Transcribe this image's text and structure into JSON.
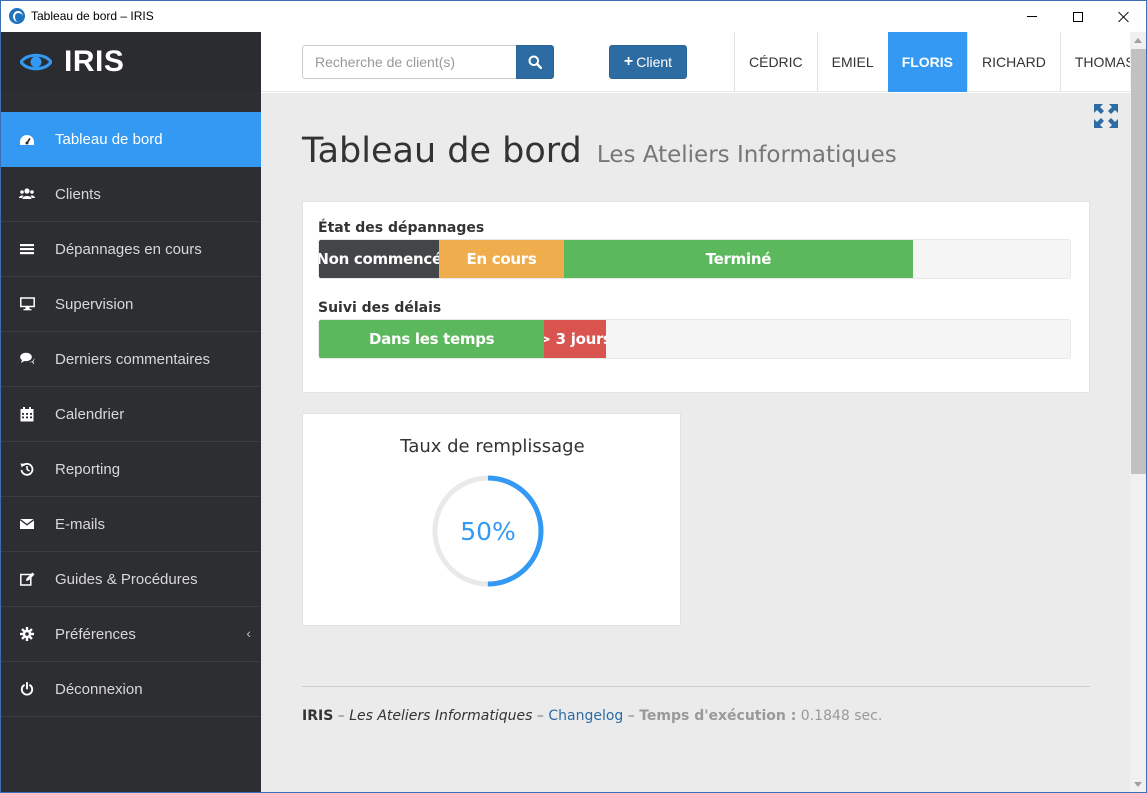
{
  "window": {
    "title": "Tableau de bord – IRIS"
  },
  "app": {
    "name": "IRIS"
  },
  "search": {
    "placeholder": "Recherche de client(s)"
  },
  "toolbar": {
    "add_client_label": "Client"
  },
  "user_tabs": [
    {
      "label": "CÉDRIC",
      "active": false
    },
    {
      "label": "EMIEL",
      "active": false
    },
    {
      "label": "FLORIS",
      "active": true
    },
    {
      "label": "RICHARD",
      "active": false
    },
    {
      "label": "THOMAS",
      "active": false
    }
  ],
  "sidebar": {
    "items": [
      {
        "label": "Tableau de bord",
        "icon": "dashboard-icon",
        "active": true
      },
      {
        "label": "Clients",
        "icon": "users-icon",
        "active": false
      },
      {
        "label": "Dépannages en cours",
        "icon": "list-icon",
        "active": false
      },
      {
        "label": "Supervision",
        "icon": "monitor-icon",
        "active": false
      },
      {
        "label": "Derniers commentaires",
        "icon": "comments-icon",
        "active": false
      },
      {
        "label": "Calendrier",
        "icon": "calendar-icon",
        "active": false
      },
      {
        "label": "Reporting",
        "icon": "history-icon",
        "active": false
      },
      {
        "label": "E-mails",
        "icon": "envelope-icon",
        "active": false
      },
      {
        "label": "Guides & Procédures",
        "icon": "edit-icon",
        "active": false
      },
      {
        "label": "Préférences",
        "icon": "gear-icon",
        "active": false
      },
      {
        "label": "Déconnexion",
        "icon": "power-icon",
        "active": false
      }
    ]
  },
  "page": {
    "title": "Tableau de bord",
    "subtitle": "Les Ateliers Informatiques"
  },
  "repairs_status": {
    "label": "État des dépannages",
    "segments": [
      {
        "label": "Non commencé",
        "percent": 16,
        "color": "#444548"
      },
      {
        "label": "En cours",
        "percent": 16.6,
        "color": "#f0ad4e"
      },
      {
        "label": "Terminé",
        "percent": 46.5,
        "color": "#5cb85c"
      }
    ]
  },
  "deadlines": {
    "label": "Suivi des délais",
    "segments": [
      {
        "label": "Dans les temps",
        "percent": 30,
        "color": "#5cb85c"
      },
      {
        "label": "> 3 jours",
        "percent": 8.2,
        "color": "#d9534f"
      }
    ]
  },
  "fill_rate": {
    "title": "Taux de remplissage",
    "value_label": "50%",
    "fraction": 0.5,
    "color": "#3399f3",
    "track_color": "#e9e9e9"
  },
  "footer": {
    "brand": "IRIS",
    "sep1": " – ",
    "company": "Les Ateliers Informatiques",
    "sep2": " – ",
    "changelog": "Changelog",
    "sep3": " – ",
    "exec_label": "Temps d'exécution :",
    "exec_value": " 0.1848 sec."
  }
}
